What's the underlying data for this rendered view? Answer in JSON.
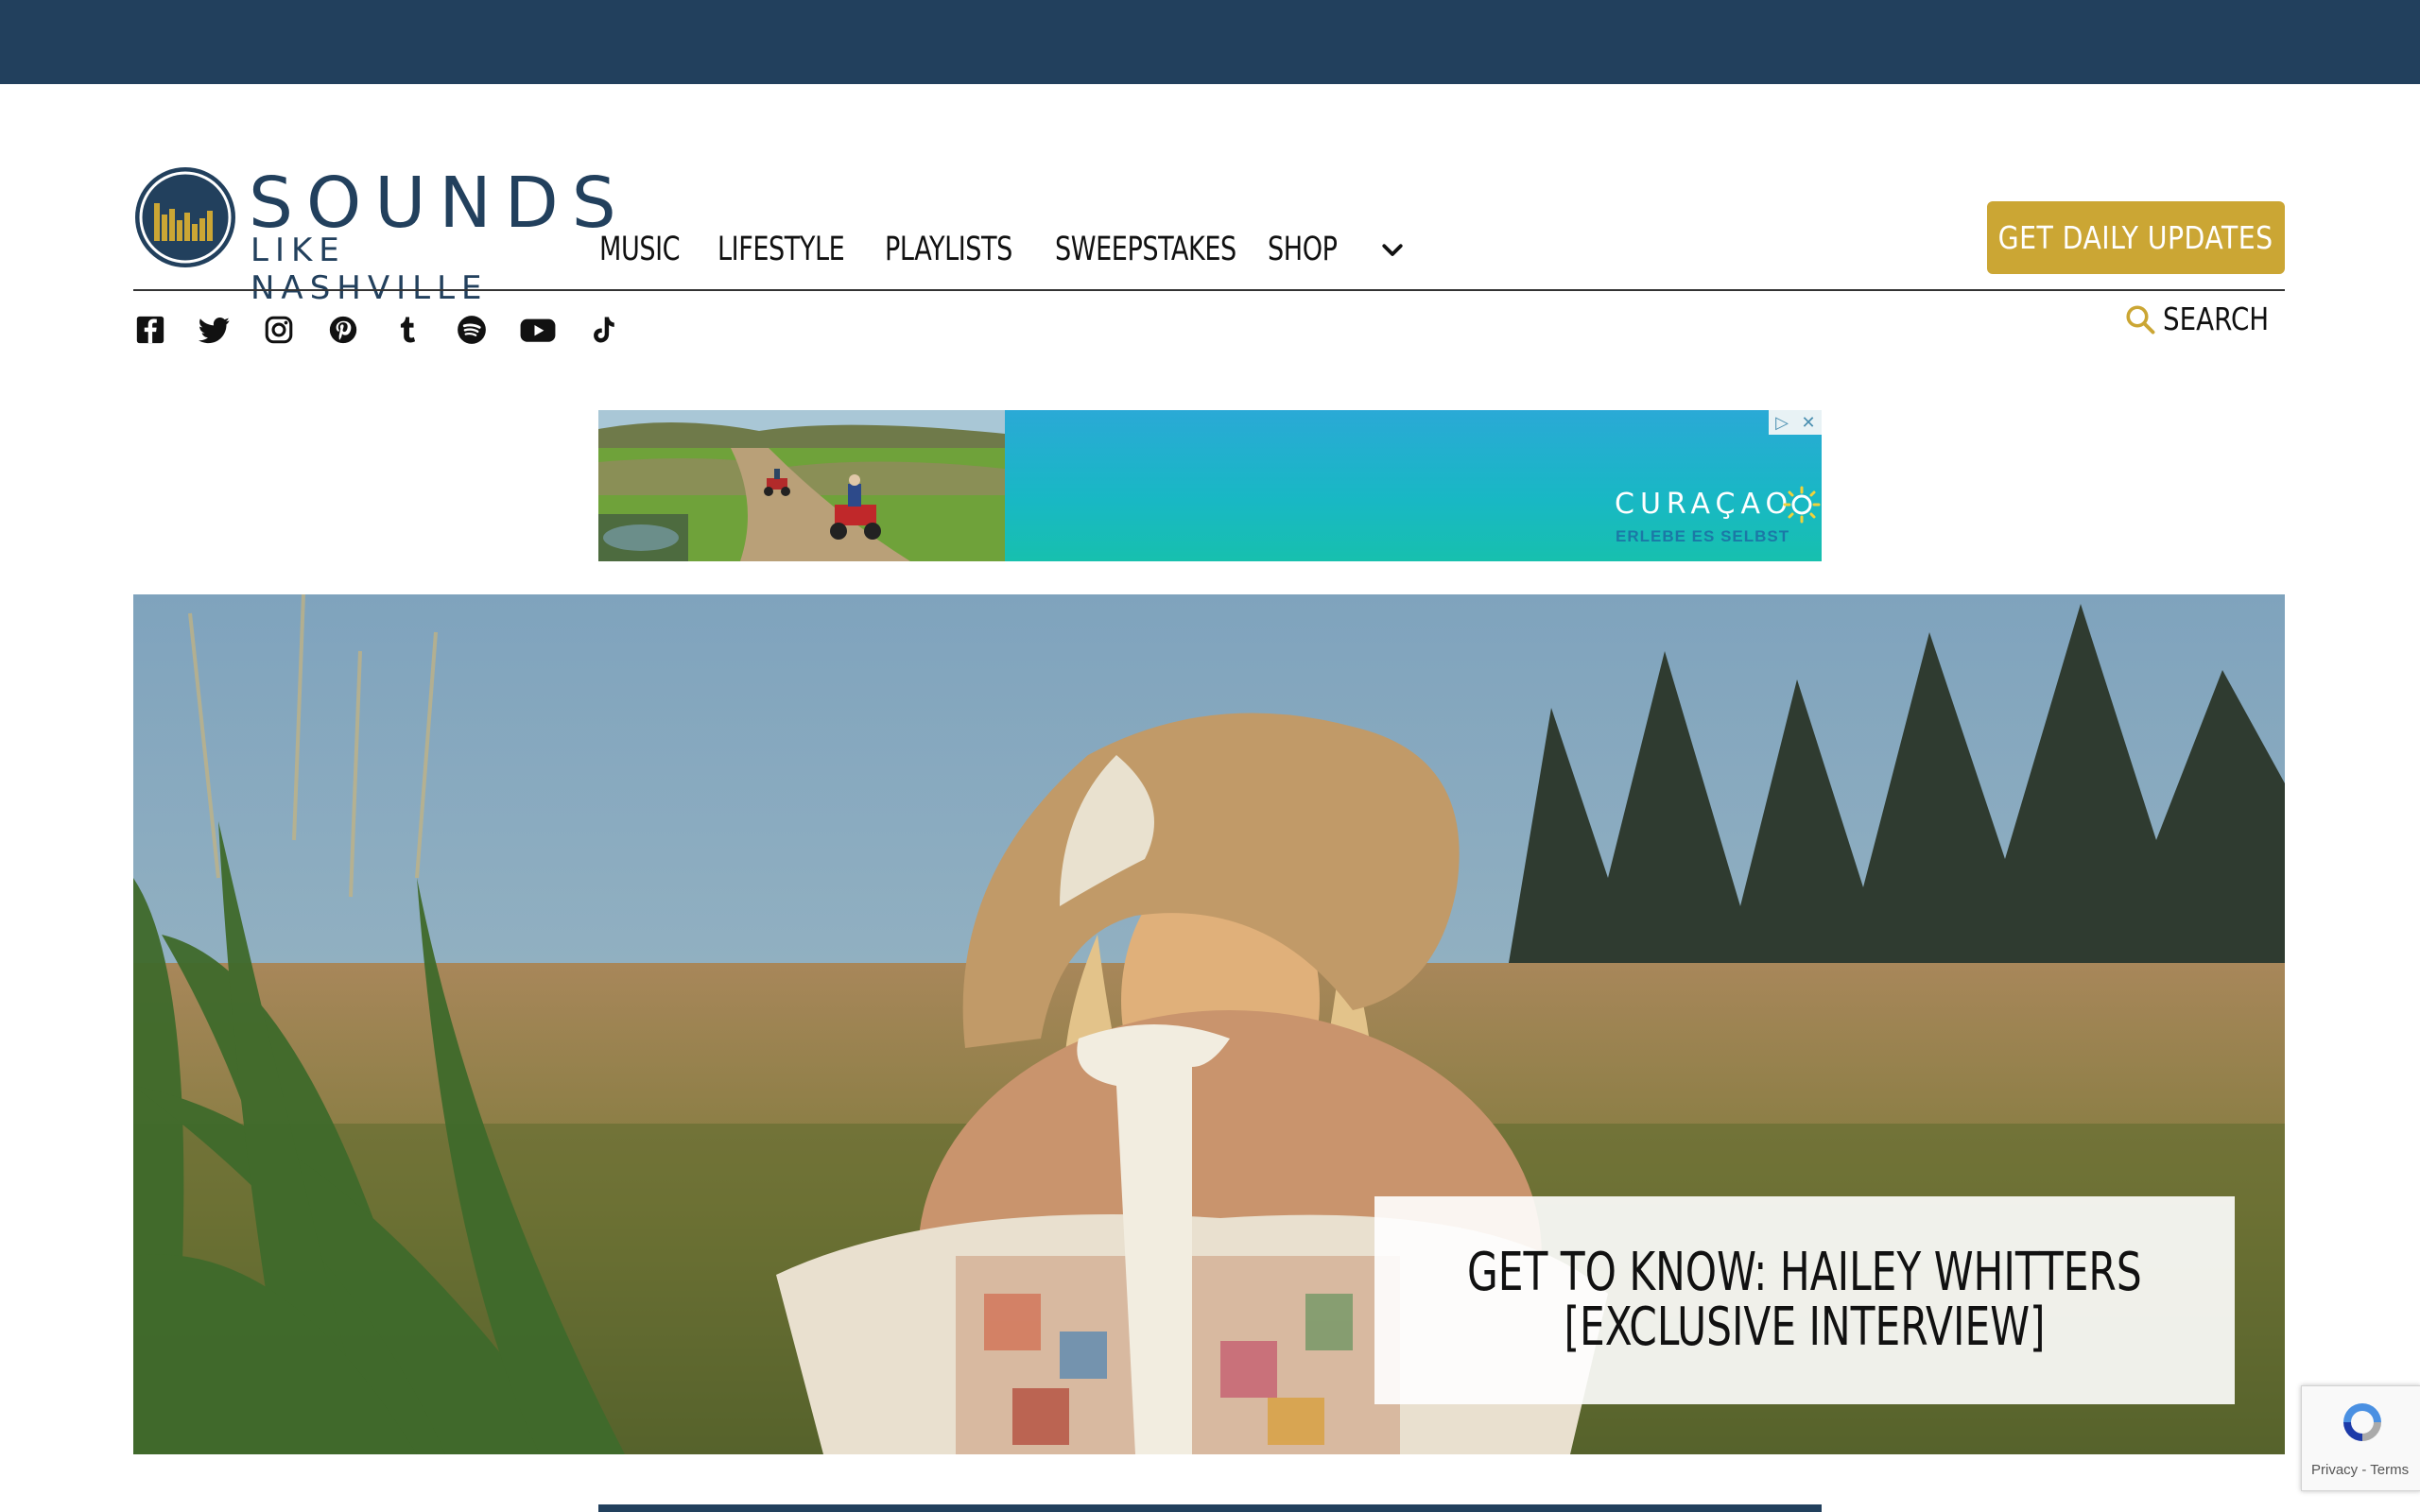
{
  "brand": {
    "line1": "SOUNDS",
    "line2": "LIKE NASHVILLE",
    "navy": "#22405d",
    "gold": "#cba634"
  },
  "nav": {
    "items": [
      "MUSIC",
      "LIFESTYLE",
      "PLAYLISTS",
      "SWEEPSTAKES",
      "SHOP"
    ],
    "more_icon": "chevron-down-icon"
  },
  "cta": {
    "label": "GET DAILY UPDATES"
  },
  "social": {
    "icons": [
      "facebook-icon",
      "twitter-icon",
      "instagram-icon",
      "pinterest-icon",
      "tumblr-icon",
      "spotify-icon",
      "youtube-icon",
      "tiktok-icon"
    ]
  },
  "search": {
    "label": "SEARCH"
  },
  "ad": {
    "brand": "CURAÇAO",
    "tagline": "ERLEBE ES SELBST"
  },
  "hero": {
    "title_line1": "GET TO KNOW: HAILEY WHITTERS",
    "title_line2": "[EXCLUSIVE INTERVIEW]"
  },
  "recaptcha": {
    "label": "Privacy - Terms"
  }
}
